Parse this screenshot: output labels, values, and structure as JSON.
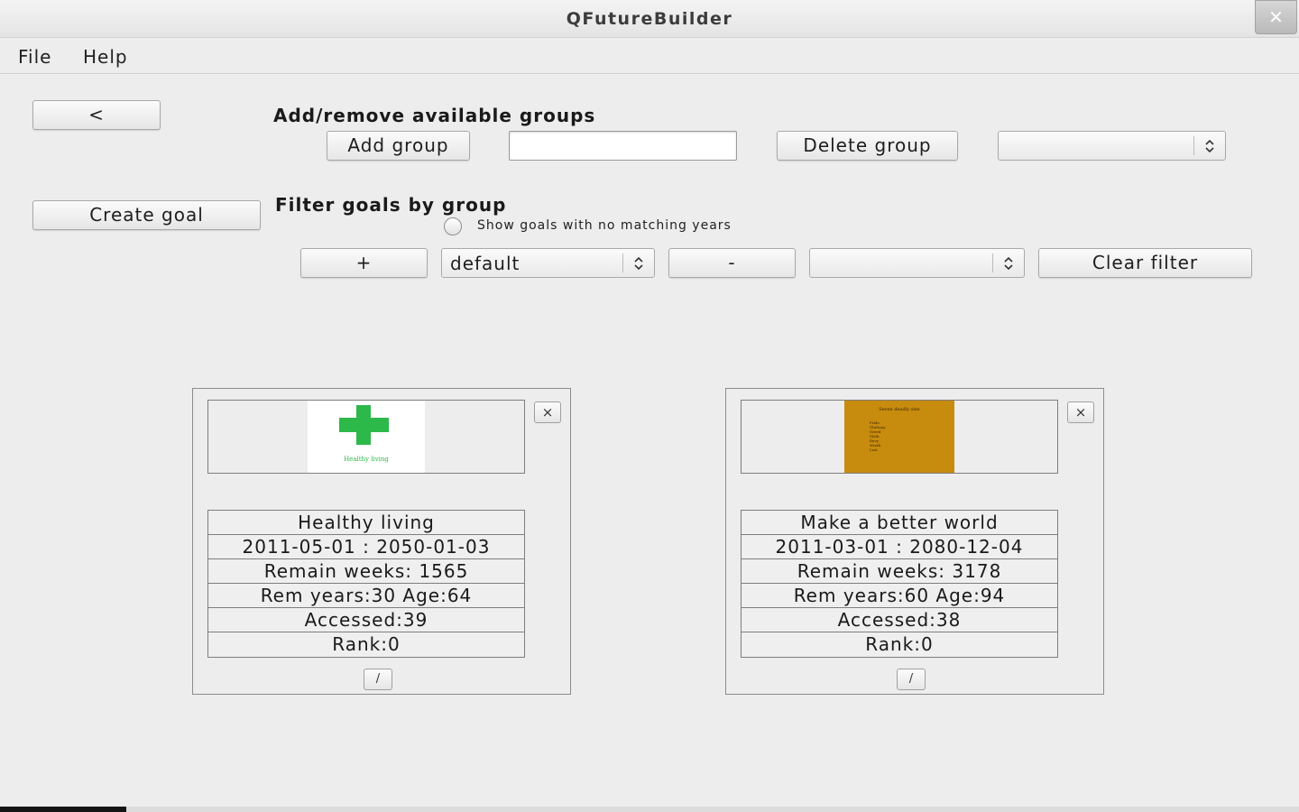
{
  "window": {
    "title": "QFutureBuilder",
    "close_glyph": "✕"
  },
  "menu": {
    "items": [
      {
        "label": "File"
      },
      {
        "label": "Help"
      }
    ]
  },
  "toolbar": {
    "back_label": "<",
    "create_goal_label": "Create goal"
  },
  "groups": {
    "heading": "Add/remove available groups",
    "add_label": "Add group",
    "group_name_value": "",
    "delete_label": "Delete group",
    "delete_select_value": ""
  },
  "filter": {
    "heading": "Filter goals by group",
    "no_matching_years_label": "Show goals with no matching years",
    "add_label": "+",
    "group_select_value": "default",
    "remove_label": "-",
    "active_select_value": "",
    "clear_label": "Clear filter"
  },
  "goals": [
    {
      "close_label": "×",
      "edit_label": "/",
      "thumbnail_icon": "green-cross-icon",
      "thumbnail_caption": "Healthy living",
      "name": "Healthy living",
      "dates": "2011-05-01 : 2050-01-03",
      "remain_weeks": "Remain weeks: 1565",
      "rem_years_age": "Rem years:30 Age:64",
      "accessed": "Accessed:39",
      "rank": "Rank:0"
    },
    {
      "close_label": "×",
      "edit_label": "/",
      "thumbnail_heading": "Seven deadly sins",
      "thumbnail_lines": [
        "Pride",
        "Gluttony",
        "Greed",
        "Sloth",
        "Envy",
        "Wrath",
        "Lust"
      ],
      "name": "Make a better world",
      "dates": "2011-03-01 : 2080-12-04",
      "remain_weeks": "Remain weeks: 3178",
      "rem_years_age": "Rem years:60 Age:94",
      "accessed": "Accessed:38",
      "rank": "Rank:0"
    }
  ],
  "colors": {
    "window_bg": "#ededed",
    "health_cross": "#2db84a",
    "sins_bg": "#c78b0e"
  }
}
